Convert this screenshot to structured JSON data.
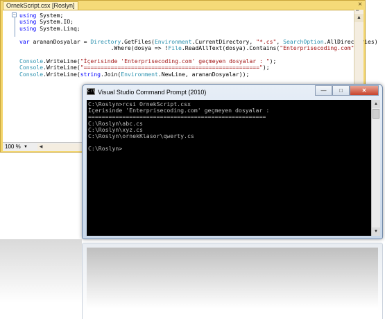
{
  "editor": {
    "tab_title": "OrnekScript.csx [Roslyn]",
    "close_glyph": "×",
    "fold_glyph": "−",
    "zoom_value": "100 %",
    "dropdown_glyph": "▼",
    "scroll_up_glyph": "▲",
    "scroll_down_glyph": "▼",
    "scroll_left_glyph": "◀",
    "scroll_right_glyph": "▶",
    "split_glyph": "═",
    "grip_glyph": "⋰"
  },
  "console": {
    "title": "Visual Studio Command Prompt (2010)",
    "icon_text": "C:\\",
    "minimize_glyph": "—",
    "maximize_glyph": "□",
    "close_glyph": "✕",
    "lines": [
      "C:\\Roslyn>rcsi OrnekScript.csx",
      "İçerisinde 'Enterprisecoding.com' geçmeyen dosyalar :",
      "====================================================",
      "C:\\Roslyn\\abc.cs",
      "C:\\Roslyn\\xyz.cs",
      "C:\\Roslyn\\ornekKlasor\\qwerty.cs",
      "",
      "C:\\Roslyn>"
    ],
    "scroll_up_glyph": "▲",
    "scroll_down_glyph": "▼"
  },
  "colors": {
    "editor_frame": "#f3d56b",
    "keyword": "#0000ff",
    "type": "#2b91af",
    "string": "#a31515",
    "console_bg": "#000000",
    "console_fg": "#c0c0c0"
  }
}
